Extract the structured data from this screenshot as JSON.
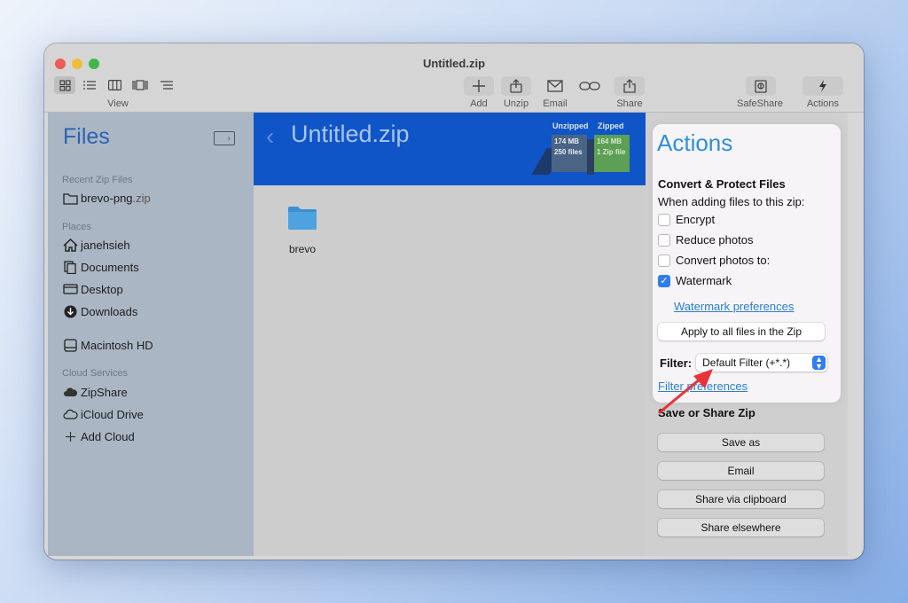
{
  "window": {
    "title": "Untitled.zip"
  },
  "toolbar": {
    "view_label": "View",
    "add_label": "Add",
    "unzip_label": "Unzip",
    "email_label": "Email",
    "share_label": "Share",
    "safeshare_label": "SafeShare",
    "actions_label": "Actions"
  },
  "sidebar": {
    "title": "Files",
    "recent_header": "Recent Zip Files",
    "recent_items": [
      {
        "name": "brevo-png",
        "ext": ".zip",
        "icon": "folder-icon"
      }
    ],
    "places_header": "Places",
    "places": [
      {
        "label": "janehsieh",
        "icon": "home-icon"
      },
      {
        "label": "Documents",
        "icon": "documents-icon"
      },
      {
        "label": "Desktop",
        "icon": "desktop-icon"
      },
      {
        "label": "Downloads",
        "icon": "download-icon"
      }
    ],
    "drive": {
      "label": "Macintosh HD",
      "icon": "hard-drive-icon"
    },
    "cloud_header": "Cloud Services",
    "cloud": [
      {
        "label": "ZipShare",
        "icon": "cloud-filled-icon"
      },
      {
        "label": "iCloud Drive",
        "icon": "cloud-outline-icon"
      },
      {
        "label": "Add Cloud",
        "icon": "plus-icon"
      }
    ]
  },
  "main": {
    "zip_title": "Untitled.zip",
    "unzipped_label": "Unzipped",
    "zipped_label": "Zipped",
    "unzipped_size": "174 MB",
    "unzipped_count": "250 files",
    "zipped_size": "164 MB",
    "zipped_count": "1 Zip file",
    "folder_name": "brevo"
  },
  "actions": {
    "title": "Actions",
    "heading": "Convert & Protect Files",
    "subheading": "When adding files to this zip:",
    "options": [
      {
        "label": "Encrypt",
        "checked": false
      },
      {
        "label": "Reduce photos",
        "checked": false
      },
      {
        "label": "Convert photos to:",
        "checked": false
      },
      {
        "label": "Watermark",
        "checked": true
      }
    ],
    "watermark_link": "Watermark preferences",
    "apply_button": "Apply to all files in the Zip",
    "filter_label": "Filter:",
    "filter_value": "Default Filter (+*.*)",
    "filter_link": "Filter preferences"
  },
  "save_share": {
    "heading": "Save or Share Zip",
    "buttons": [
      "Save as",
      "Email",
      "Share via clipboard",
      "Share elsewhere"
    ]
  },
  "colors": {
    "banner": "#0f55c8",
    "accent": "#2a8fe0",
    "annotation_arrow": "#e8333a",
    "checkbox_on": "#2f7ef0"
  }
}
